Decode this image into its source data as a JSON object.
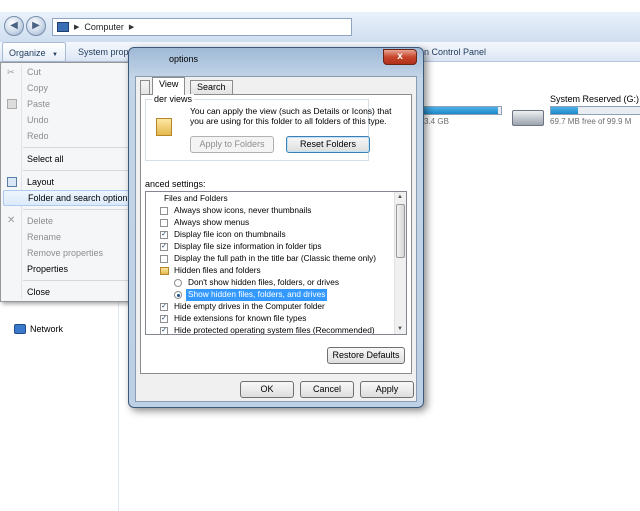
{
  "explorer": {
    "breadcrumb": [
      "Computer"
    ],
    "toolbar": {
      "organize_label": "Organize",
      "system_properties_label": "System properties",
      "control_panel_label": "n Control Panel"
    },
    "drives": [
      {
        "name": "System Reserved (G:)",
        "free_text": "69.7 MB free of 99.9 M",
        "used_fraction": 0.3
      }
    ],
    "partial_drive_text": "3.4 GB",
    "partial_drive_used_fraction": 0.97,
    "nav": {
      "network_label": "Network"
    }
  },
  "organize_menu": {
    "items": [
      {
        "label": "Cut",
        "enabled": false,
        "icon": "scissors-icon"
      },
      {
        "label": "Copy",
        "enabled": false,
        "icon": "copy-icon"
      },
      {
        "label": "Paste",
        "enabled": false,
        "icon": "paste-icon"
      },
      {
        "label": "Undo",
        "enabled": false
      },
      {
        "label": "Redo",
        "enabled": false
      },
      {
        "label": "Select all",
        "enabled": true
      },
      {
        "label": "Layout",
        "enabled": true,
        "icon": "layout-icon",
        "submenu": true
      },
      {
        "label": "Folder and search options",
        "enabled": true,
        "highlighted": true
      },
      {
        "label": "Delete",
        "enabled": false,
        "icon": "delete-x-icon"
      },
      {
        "label": "Rename",
        "enabled": false
      },
      {
        "label": "Remove properties",
        "enabled": false
      },
      {
        "label": "Properties",
        "enabled": true
      },
      {
        "label": "Close",
        "enabled": true
      }
    ]
  },
  "dialog": {
    "title": "options",
    "close_label": "x",
    "tabs": [
      {
        "label": "",
        "active": false
      },
      {
        "label": "View",
        "active": true
      },
      {
        "label": "Search",
        "active": false
      }
    ],
    "folder_views": {
      "group_label": "der views",
      "description": "You can apply the view (such as Details or Icons) that you are using for this folder to all folders of this type.",
      "apply_button": "Apply to Folders",
      "reset_button": "Reset Folders"
    },
    "advanced_label": "anced settings:",
    "advanced_items": [
      {
        "type": "header",
        "label": "Files and Folders"
      },
      {
        "type": "checkbox",
        "label": "Always show icons, never thumbnails",
        "checked": false
      },
      {
        "type": "checkbox",
        "label": "Always show menus",
        "checked": false
      },
      {
        "type": "checkbox",
        "label": "Display file icon on thumbnails",
        "checked": true
      },
      {
        "type": "checkbox",
        "label": "Display file size information in folder tips",
        "checked": true
      },
      {
        "type": "checkbox",
        "label": "Display the full path in the title bar (Classic theme only)",
        "checked": false
      },
      {
        "type": "folder",
        "label": "Hidden files and folders"
      },
      {
        "type": "radio",
        "label": "Don't show hidden files, folders, or drives",
        "checked": false
      },
      {
        "type": "radio",
        "label": "Show hidden files, folders, and drives",
        "checked": true,
        "selected": true
      },
      {
        "type": "checkbox",
        "label": "Hide empty drives in the Computer folder",
        "checked": true
      },
      {
        "type": "checkbox",
        "label": "Hide extensions for known file types",
        "checked": true
      },
      {
        "type": "checkbox",
        "label": "Hide protected operating system files (Recommended)",
        "checked": true
      }
    ],
    "restore_defaults": "Restore Defaults",
    "ok": "OK",
    "cancel": "Cancel",
    "apply": "Apply"
  }
}
